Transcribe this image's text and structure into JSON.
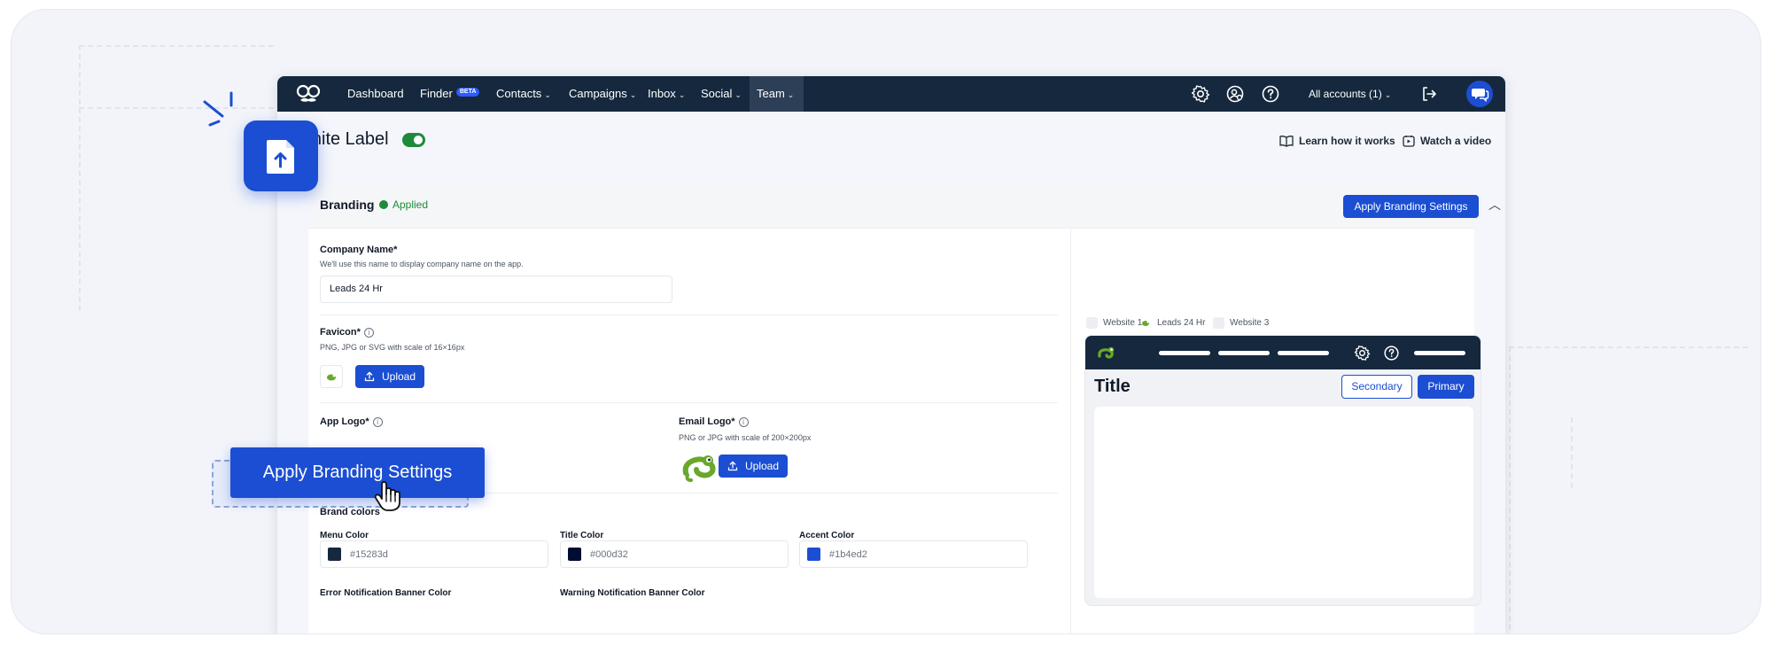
{
  "nav": {
    "items": [
      {
        "label": "Dashboard"
      },
      {
        "label": "Finder",
        "badge": "BETA"
      },
      {
        "label": "Contacts"
      },
      {
        "label": "Campaigns"
      },
      {
        "label": "Inbox"
      },
      {
        "label": "Social"
      },
      {
        "label": "Team"
      }
    ],
    "accounts_label": "All accounts (1)",
    "icons": [
      "settings-icon",
      "agency-user-icon",
      "help-icon",
      "logout-icon",
      "chat-icon"
    ]
  },
  "header": {
    "title": "White Label",
    "toggle_on": true,
    "learn_link": "Learn how it works",
    "video_link": "Watch a video"
  },
  "branding": {
    "section_title": "Branding",
    "status": "Applied",
    "apply_button": "Apply Branding Settings",
    "company_name": {
      "label": "Company Name*",
      "hint": "We'll use this name to display company name on the app.",
      "value": "Leads 24 Hr"
    },
    "favicon": {
      "label": "Favicon*",
      "hint": "PNG, JPG or SVG with scale of 16×16px",
      "upload": "Upload"
    },
    "app_logo": {
      "label": "App Logo*"
    },
    "email_logo": {
      "label": "Email Logo*",
      "hint": "PNG or JPG with scale of 200×200px",
      "upload": "Upload"
    },
    "brand_colors": {
      "title": "Brand colors",
      "menu": {
        "label": "Menu Color",
        "value": "#15283d"
      },
      "title_color": {
        "label": "Title Color",
        "value": "#000d32"
      },
      "accent": {
        "label": "Accent Color",
        "value": "#1b4ed2"
      },
      "error_label": "Error Notification Banner Color",
      "warning_label": "Warning Notification Banner Color"
    }
  },
  "preview": {
    "tabs": [
      "Website 1",
      "Leads 24 Hr",
      "Website 3"
    ],
    "title": "Title",
    "secondary": "Secondary",
    "primary": "Primary"
  },
  "overlay": {
    "apply_button": "Apply Branding Settings"
  },
  "colors": {
    "menu": "#15283d",
    "accent": "#1b4ed2",
    "success": "#1f8a3b"
  }
}
